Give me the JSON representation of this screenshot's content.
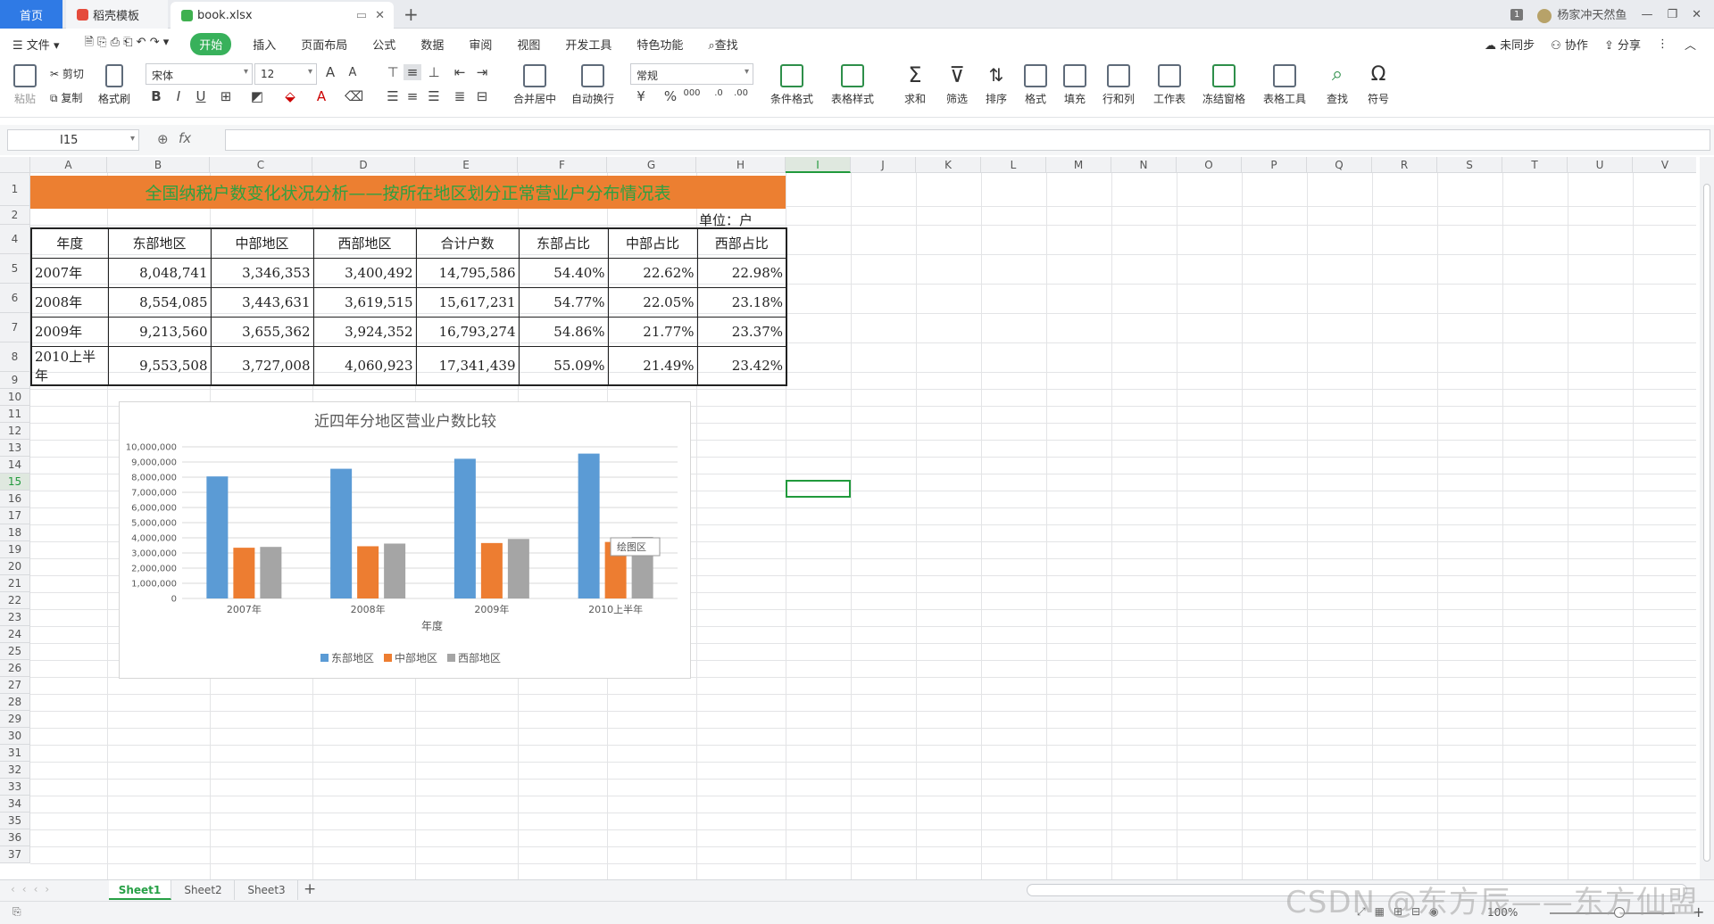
{
  "tabbar": {
    "home": "首页",
    "template": "稻壳模板",
    "file": "book.xlsx",
    "badge": "1",
    "user": "杨家冲天然鱼"
  },
  "menu": {
    "file": "文件",
    "items": [
      "开始",
      "插入",
      "页面布局",
      "公式",
      "数据",
      "审阅",
      "视图",
      "开发工具",
      "特色功能"
    ],
    "search": "查找",
    "right": [
      "未同步",
      "协作",
      "分享"
    ]
  },
  "ribbon": {
    "paste": "粘贴",
    "cut": "剪切",
    "copy": "复制",
    "format_painter": "格式刷",
    "font": "宋体",
    "size": "12",
    "merge": "合并居中",
    "wrap": "自动换行",
    "numfmt": "常规",
    "cond": "条件格式",
    "tstyle": "表格样式",
    "sum": "求和",
    "filter": "筛选",
    "sort": "排序",
    "format": "格式",
    "fill": "填充",
    "rowcol": "行和列",
    "sheet": "工作表",
    "freeze": "冻结窗格",
    "ttool": "表格工具",
    "find": "查找",
    "symbol": "符号"
  },
  "formula": {
    "namebox": "I15",
    "fx": "fx"
  },
  "columns": [
    "A",
    "B",
    "C",
    "D",
    "E",
    "F",
    "G",
    "H",
    "I",
    "J",
    "K",
    "L",
    "M",
    "N",
    "O",
    "P",
    "Q",
    "R",
    "S",
    "T",
    "U",
    "V"
  ],
  "rows": [
    "1",
    "2",
    "4",
    "5",
    "6",
    "7",
    "8",
    "9",
    "10",
    "11",
    "12",
    "13",
    "14",
    "15",
    "16",
    "17",
    "18",
    "19",
    "20",
    "21",
    "22",
    "23",
    "24",
    "25",
    "26",
    "27",
    "28",
    "29",
    "30",
    "31",
    "32",
    "33",
    "34",
    "35",
    "36",
    "37"
  ],
  "sheet": {
    "title": "全国纳税户数变化状况分析——按所在地区划分正常营业户分布情况表",
    "unit": "单位：户",
    "headers": [
      "年度",
      "东部地区",
      "中部地区",
      "西部地区",
      "合计户数",
      "东部占比",
      "中部占比",
      "西部占比"
    ],
    "rows": [
      [
        "2007年",
        "8,048,741",
        "3,346,353",
        "3,400,492",
        "14,795,586",
        "54.40%",
        "22.62%",
        "22.98%"
      ],
      [
        "2008年",
        "8,554,085",
        "3,443,631",
        "3,619,515",
        "15,617,231",
        "54.77%",
        "22.05%",
        "23.18%"
      ],
      [
        "2009年",
        "9,213,560",
        "3,655,362",
        "3,924,352",
        "16,793,274",
        "54.86%",
        "21.77%",
        "23.37%"
      ],
      [
        "2010上半年",
        "9,553,508",
        "3,727,008",
        "4,060,923",
        "17,341,439",
        "55.09%",
        "21.49%",
        "23.42%"
      ]
    ]
  },
  "chart_data": {
    "type": "bar",
    "title": "近四年分地区营业户数比较",
    "xlabel": "年度",
    "ylabel": "",
    "categories": [
      "2007年",
      "2008年",
      "2009年",
      "2010上半年"
    ],
    "series": [
      {
        "name": "东部地区",
        "color": "#5b9bd5",
        "values": [
          8048741,
          8554085,
          9213560,
          9553508
        ]
      },
      {
        "name": "中部地区",
        "color": "#ed7d31",
        "values": [
          3346353,
          3443631,
          3655362,
          3727008
        ]
      },
      {
        "name": "西部地区",
        "color": "#a5a5a5",
        "values": [
          3400492,
          3619515,
          3924352,
          4060923
        ]
      }
    ],
    "ylim": [
      0,
      10000000
    ],
    "yticks": [
      "0",
      "1,000,000",
      "2,000,000",
      "3,000,000",
      "4,000,000",
      "5,000,000",
      "6,000,000",
      "7,000,000",
      "8,000,000",
      "9,000,000",
      "10,000,000"
    ],
    "grid": true,
    "legend": "bottom",
    "tooltip": "绘图区"
  },
  "sheettabs": [
    "Sheet1",
    "Sheet2",
    "Sheet3"
  ],
  "status": {
    "zoom": "100%",
    "watermark": "CSDN @东方辰——东方仙盟"
  }
}
